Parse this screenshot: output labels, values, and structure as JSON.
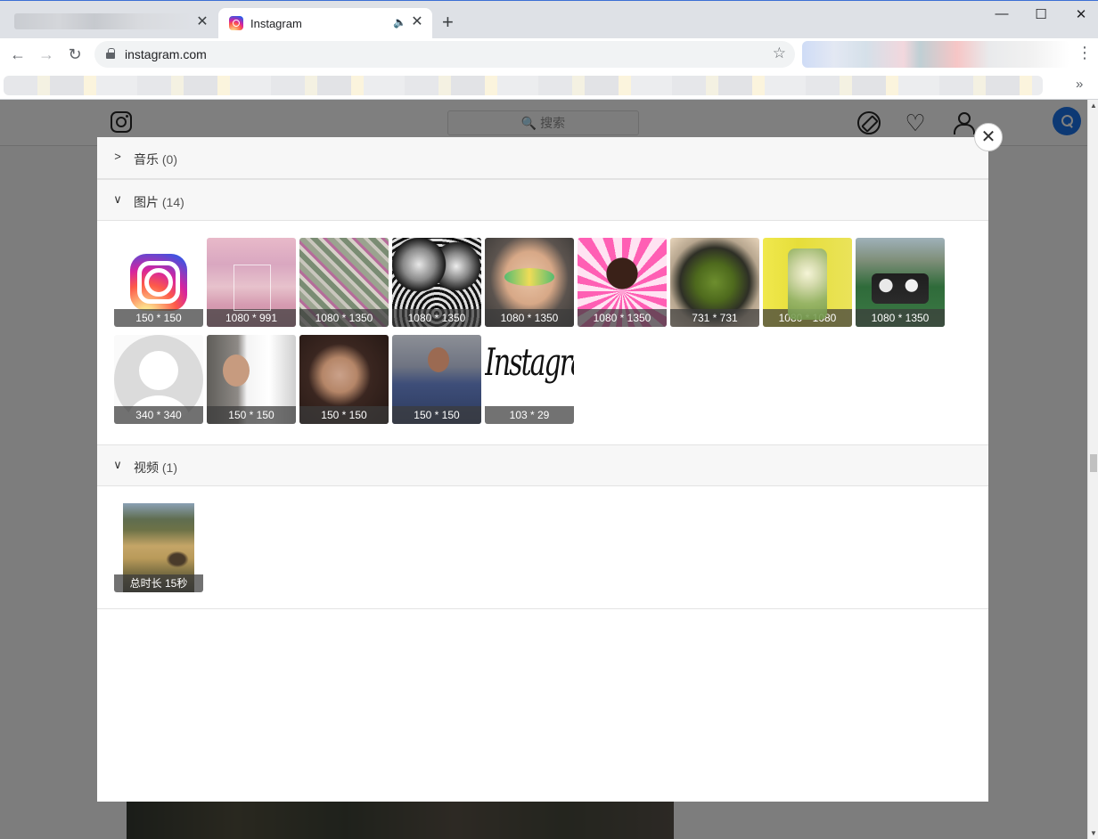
{
  "browser": {
    "tab_active_title": "Instagram",
    "tab_close": "✕",
    "new_tab": "+",
    "url": "instagram.com",
    "window_controls": [
      "—",
      "☐",
      "✕"
    ]
  },
  "instagram": {
    "search_placeholder": "🔍 搜索"
  },
  "modal": {
    "close_label": "✕",
    "sections": {
      "music": {
        "chevron": ">",
        "label": "音乐",
        "count": "(0)"
      },
      "images": {
        "chevron": "∨",
        "label": "图片",
        "count": "(14)"
      },
      "videos": {
        "chevron": "∨",
        "label": "视频",
        "count": "(1)"
      }
    },
    "images": [
      {
        "caption": "150 * 150",
        "icon": "instagram-logo"
      },
      {
        "caption": "1080 * 991",
        "icon": "pink-landscape"
      },
      {
        "caption": "1080 * 1350",
        "icon": "aerial-street"
      },
      {
        "caption": "1080 * 1350",
        "icon": "chrome-objects"
      },
      {
        "caption": "1080 * 1350",
        "icon": "makeup-portrait"
      },
      {
        "caption": "1080 * 1350",
        "icon": "curly-hair-portrait"
      },
      {
        "caption": "731 * 731",
        "icon": "food-plate"
      },
      {
        "caption": "1080 * 1080",
        "icon": "glass-vase"
      },
      {
        "caption": "1080 * 1350",
        "icon": "two-men-field"
      },
      {
        "caption": "340 * 340",
        "icon": "default-avatar"
      },
      {
        "caption": "150 * 150",
        "icon": "woman-headscarf"
      },
      {
        "caption": "150 * 150",
        "icon": "woman-selfie"
      },
      {
        "caption": "150 * 150",
        "icon": "man-portrait"
      },
      {
        "caption": "103 * 29",
        "icon": "instagram-wordmark",
        "wordmark_text": "Instagram"
      }
    ],
    "videos": [
      {
        "caption": "总时长 15秒",
        "icon": "hillside-animal"
      }
    ]
  }
}
